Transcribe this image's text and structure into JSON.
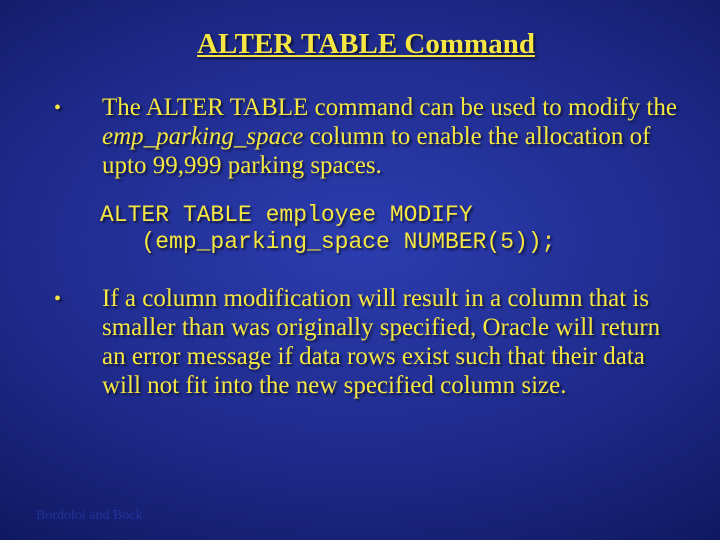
{
  "title": "ALTER TABLE Command",
  "bullets": [
    {
      "parts": [
        {
          "text": "The ALTER TABLE command can be used to modify the ",
          "italic": false
        },
        {
          "text": "emp_parking_space",
          "italic": true
        },
        {
          "text": " column to enable the allocation of upto 99,999 parking spaces.",
          "italic": false
        }
      ]
    }
  ],
  "code": "ALTER TABLE employee MODIFY\n   (emp_parking_space NUMBER(5));",
  "bullets2": [
    {
      "parts": [
        {
          "text": "If a column modification will result in a column that is smaller than was originally specified, Oracle will return an error message if data rows exist such that their data will not fit into the new specified column size.",
          "italic": false
        }
      ]
    }
  ],
  "footer": "Bordoloi and Bock",
  "bullet_symbol": "•"
}
